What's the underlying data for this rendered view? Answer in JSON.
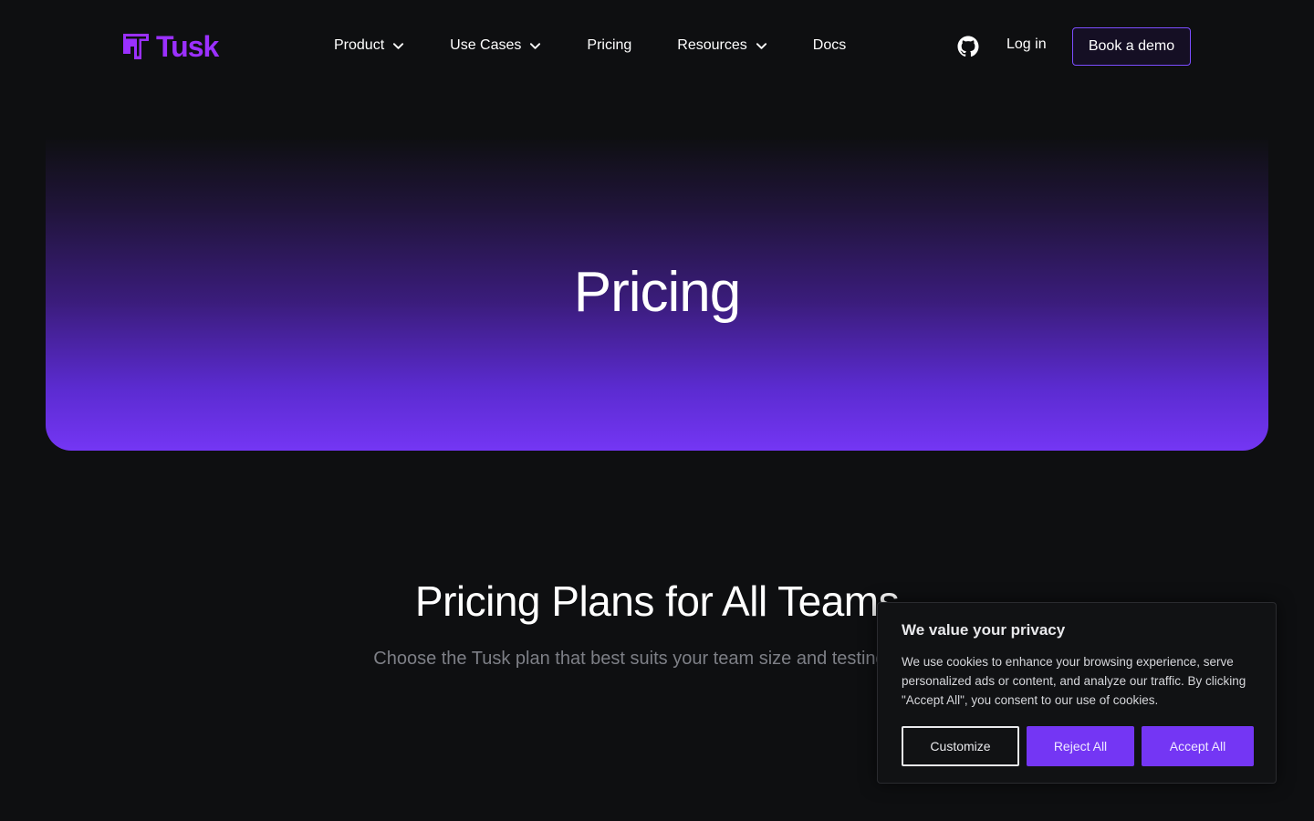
{
  "header": {
    "logo_text": "Tusk",
    "nav": [
      {
        "label": "Product",
        "has_dropdown": true
      },
      {
        "label": "Use Cases",
        "has_dropdown": true
      },
      {
        "label": "Pricing",
        "has_dropdown": false
      },
      {
        "label": "Resources",
        "has_dropdown": true
      },
      {
        "label": "Docs",
        "has_dropdown": false
      }
    ],
    "github_icon": "github-icon",
    "login_label": "Log in",
    "demo_label": "Book a demo"
  },
  "hero": {
    "title": "Pricing"
  },
  "plans": {
    "title": "Pricing Plans for All Teams",
    "subtitle": "Choose the Tusk plan that best suits your team size and testing needs"
  },
  "cookie": {
    "title": "We value your privacy",
    "body": "We use cookies to enhance your browsing experience, serve personalized ads or content, and analyze our traffic. By clicking \"Accept All\", you consent to our use of cookies.",
    "customize_label": "Customize",
    "reject_label": "Reject All",
    "accept_label": "Accept All"
  },
  "colors": {
    "brand": "#9b30ff",
    "accent": "#7436f4",
    "background": "#0e0f11"
  }
}
